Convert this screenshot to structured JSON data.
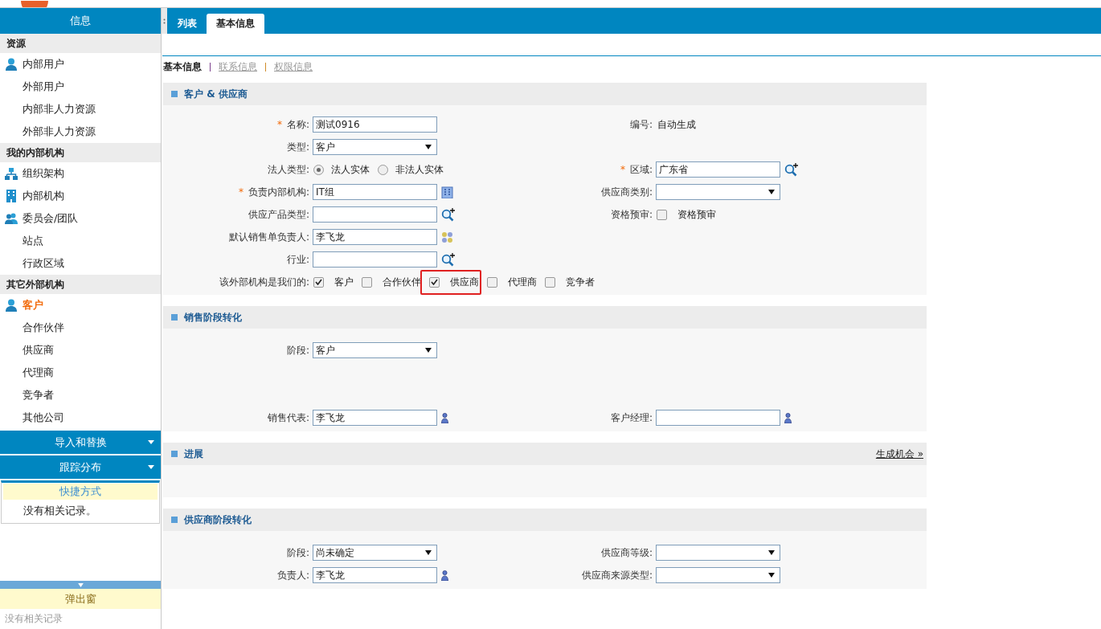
{
  "sidebar": {
    "title": "信息",
    "groups": [
      {
        "title": "资源",
        "items": [
          {
            "label": "内部用户",
            "kind": "user",
            "selected": false
          },
          {
            "label": "外部用户",
            "kind": "plain",
            "selected": false
          },
          {
            "label": "内部非人力资源",
            "kind": "plain",
            "selected": false
          },
          {
            "label": "外部非人力资源",
            "kind": "plain",
            "selected": false
          }
        ]
      },
      {
        "title": "我的内部机构",
        "items": [
          {
            "label": "组织架构",
            "kind": "org",
            "selected": false
          },
          {
            "label": "内部机构",
            "kind": "unit",
            "selected": false
          },
          {
            "label": "委员会/团队",
            "kind": "team",
            "selected": false
          },
          {
            "label": "站点",
            "kind": "plain",
            "selected": false
          },
          {
            "label": "行政区域",
            "kind": "plain",
            "selected": false
          }
        ]
      },
      {
        "title": "其它外部机构",
        "items": [
          {
            "label": "客户",
            "kind": "user",
            "selected": true
          },
          {
            "label": "合作伙伴",
            "kind": "plain",
            "selected": false
          },
          {
            "label": "供应商",
            "kind": "plain",
            "selected": false
          },
          {
            "label": "代理商",
            "kind": "plain",
            "selected": false
          },
          {
            "label": "竞争者",
            "kind": "plain",
            "selected": false
          },
          {
            "label": "其他公司",
            "kind": "plain",
            "selected": false
          }
        ]
      }
    ],
    "accordions": [
      "导入和替换",
      "跟踪分布"
    ],
    "shortcuts": {
      "title": "快捷方式",
      "empty": "没有相关记录。"
    },
    "popup": {
      "title": "弹出窗",
      "empty": "没有相关记录"
    }
  },
  "tabs": [
    {
      "label": "列表",
      "selected": false
    },
    {
      "label": "基本信息",
      "selected": true
    }
  ],
  "subnav": [
    {
      "label": "基本信息",
      "selected": true
    },
    {
      "label": "联系信息",
      "selected": false
    },
    {
      "label": "权限信息",
      "selected": false
    }
  ],
  "sections": [
    {
      "title": "客户 & 供应商",
      "rows": [
        {
          "left": {
            "kind": "input",
            "mark": "*",
            "label": "名称:",
            "value": "测试0916"
          },
          "right": {
            "kind": "text",
            "label": "编号:",
            "value": "自动生成"
          }
        },
        {
          "left": {
            "kind": "select",
            "label": "类型:",
            "value": "客户"
          }
        },
        {
          "left": {
            "kind": "radio",
            "label": "法人类型:",
            "options": [
              {
                "label": "法人实体",
                "selected": true
              },
              {
                "label": "非法人实体",
                "selected": false
              }
            ]
          },
          "right": {
            "kind": "input",
            "mark": "*",
            "label": "区域:",
            "value": "广东省",
            "picker": {
              "kind": "lookup"
            }
          }
        },
        {
          "left": {
            "kind": "input",
            "mark": "*",
            "label": "负责内部机构:",
            "value": "IT组",
            "picker": {
              "kind": "org"
            }
          },
          "right": {
            "kind": "select",
            "label": "供应商类别:"
          }
        },
        {
          "left": {
            "kind": "input",
            "label": "供应产品类型:",
            "picker": {
              "kind": "lookup"
            }
          },
          "right": {
            "kind": "checks",
            "label": "资格预审:",
            "options": [
              {
                "label": "资格预审",
                "checked": false
              }
            ]
          }
        },
        {
          "left": {
            "kind": "input",
            "label": "默认销售单负责人:",
            "value": "李飞龙",
            "picker": {
              "kind": "group"
            }
          }
        },
        {
          "left": {
            "kind": "input",
            "label": "行业:",
            "picker": {
              "kind": "lookup"
            }
          }
        },
        {
          "left": {
            "kind": "checks",
            "label": "该外部机构是我们的:",
            "options": [
              {
                "label": "客户",
                "checked": true
              },
              {
                "label": "合作伙伴",
                "checked": false
              },
              {
                "label": "供应商",
                "checked": true,
                "highlighted": true
              },
              {
                "label": "代理商",
                "checked": false
              },
              {
                "label": "竞争者",
                "checked": false
              }
            ]
          }
        }
      ]
    },
    {
      "title": "销售阶段转化",
      "rows": [
        {
          "left": {
            "kind": "select",
            "label": "阶段:",
            "value": "客户"
          }
        },
        {
          "left": {
            "kind": "input",
            "label": "销售代表:",
            "value": "李飞龙",
            "picker": {
              "kind": "user"
            }
          },
          "right": {
            "kind": "input",
            "label": "客户经理:",
            "picker": {
              "kind": "user"
            }
          }
        }
      ]
    },
    {
      "title": "进展",
      "link": "生成机会 »"
    },
    {
      "title": "供应商阶段转化",
      "rows": [
        {
          "left": {
            "kind": "select",
            "label": "阶段:",
            "value": "尚未确定"
          },
          "right": {
            "kind": "select",
            "label": "供应商等级:"
          }
        },
        {
          "left": {
            "kind": "input",
            "label": "负责人:",
            "value": "李飞龙",
            "picker": {
              "kind": "user"
            }
          },
          "right": {
            "kind": "select",
            "label": "供应商来源类型:"
          }
        }
      ]
    }
  ]
}
